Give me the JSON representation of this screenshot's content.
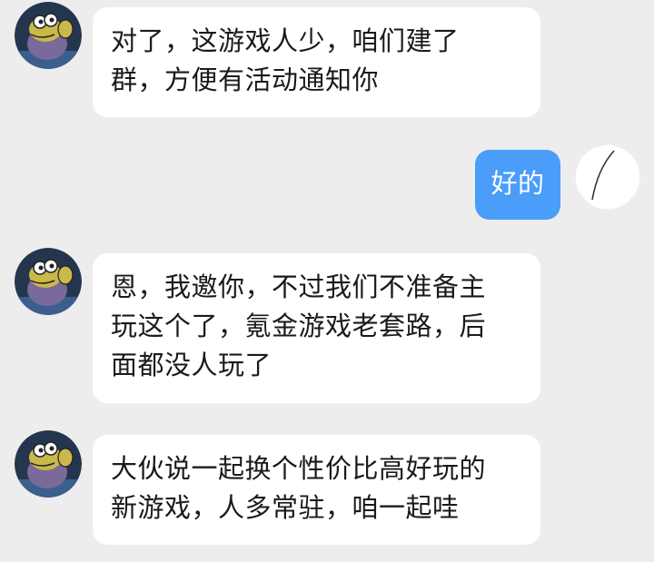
{
  "chat": {
    "messages": [
      {
        "sender": "other",
        "lines": [
          "对了，这游戏人少，咱们建了",
          "群，方便有活动通知你"
        ]
      },
      {
        "sender": "self",
        "lines": [
          "好的"
        ]
      },
      {
        "sender": "other",
        "lines": [
          "恩，我邀你，不过我们不准备主",
          "玩这个了，氪金游戏老套路，后",
          "面都没人玩了"
        ]
      },
      {
        "sender": "other",
        "lines": [
          "大伙说一起换个性价比高好玩的",
          "新游戏，人多常驻，咱一起哇"
        ]
      }
    ]
  },
  "colors": {
    "background": "#ededed",
    "bubble_other": "#ffffff",
    "bubble_self": "#4a9df8"
  },
  "icons": {
    "other_avatar": "cartoon-flexing-avatar-icon",
    "self_avatar": "white-avatar-icon"
  }
}
